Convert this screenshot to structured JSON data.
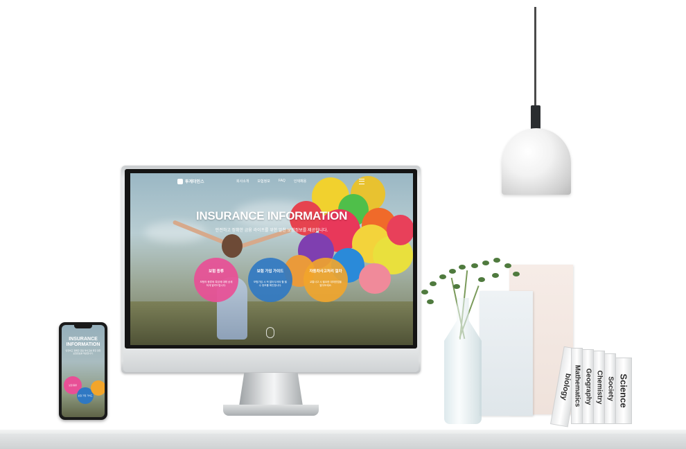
{
  "site": {
    "logo_text": "투게더인스",
    "menu": [
      "회사소개",
      "보험정보",
      "FAQ",
      "인재채용"
    ],
    "hero_title": "INSURANCE INFORMATION",
    "hero_subtitle": "안전하고 정확한 금융 라이프를 위한 알찬 보험정보를 제공합니다.",
    "cards": [
      {
        "title": "보험 종류",
        "desc": "보험의 종류와 특징에 대해 상세하게 알려드립니다.",
        "color": "#e84f96"
      },
      {
        "title": "보험 가입 가이드",
        "desc": "보험가입 시 꼭 알아두어야 할 필수 정보를 확인합니다.",
        "color": "#2f78c3"
      },
      {
        "title": "자동차사고처리 절차",
        "desc": "교통사고 시 필요한 대처방법을 알아보세요.",
        "color": "#f2a52b"
      }
    ]
  },
  "phone": {
    "title": "INSURANCE INFORMATION",
    "subtitle": "안전하고 정확한 금융 라이프를 위한 알찬 보험정보를 제공합니다.",
    "card1": "보험 종류",
    "card2": "보험 가입 가이드"
  },
  "books": [
    "biology",
    "Mathematics",
    "Geography",
    "Chemistry",
    "Society",
    "Science"
  ]
}
